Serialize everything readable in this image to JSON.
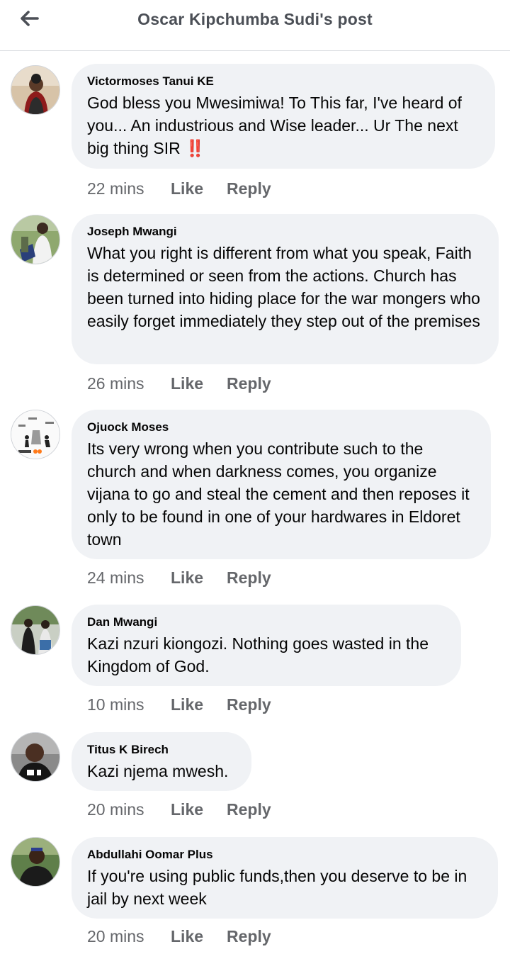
{
  "header": {
    "title": "Oscar Kipchumba Sudi's post"
  },
  "actions": {
    "like": "Like",
    "reply": "Reply"
  },
  "colors": {
    "bubble": "#f0f2f5",
    "meta_text": "#65676b",
    "header_text": "#4b4f56"
  },
  "comments": [
    {
      "author": "Victormoses Tanui KE",
      "text": "God bless you Mwesimiwa! To This far, I've heard of you... An industrious and Wise leader... Ur The next big thing SIR ",
      "emoji": "‼️",
      "time": "22 mins"
    },
    {
      "author": "Joseph Mwangi",
      "text": "What you right is different from what you speak, Faith is determined or seen from the actions. Church has been turned into hiding place for the war mongers who easily forget immediately they step out of the premises",
      "time": "26 mins"
    },
    {
      "author": "Ojuock Moses",
      "text": "Its very wrong when you contribute such to the church and when darkness comes, you organize vijana to go and steal the cement and then reposes it only to be found in one of your hardwares in Eldoret town",
      "time": "24 mins"
    },
    {
      "author": "Dan Mwangi",
      "text": "Kazi nzuri kiongozi. Nothing goes wasted in the Kingdom of God.",
      "time": "10 mins"
    },
    {
      "author": "Titus K Birech",
      "text": "Kazi njema mwesh.",
      "time": "20 mins"
    },
    {
      "author": "Abdullahi Oomar Plus",
      "text": "If you're using public funds,then you deserve to be in jail by next week",
      "time": "20 mins"
    }
  ]
}
